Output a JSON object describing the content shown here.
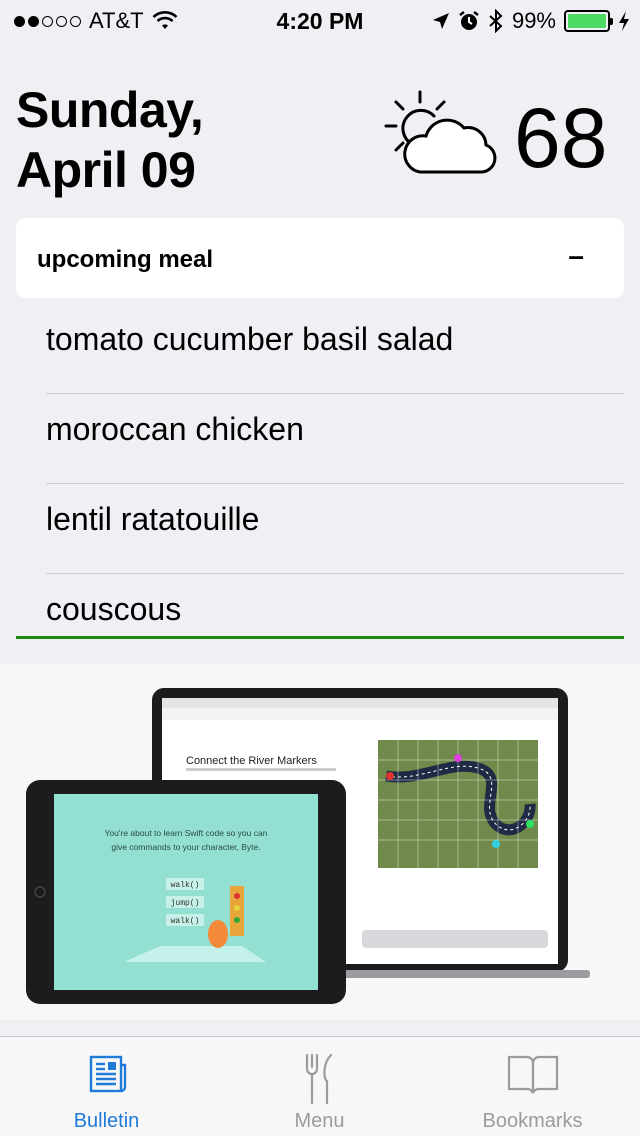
{
  "status_bar": {
    "signal_dots": [
      true,
      true,
      false,
      false,
      false
    ],
    "carrier": "AT&T",
    "time": "4:20 PM",
    "battery_percent": "99%",
    "battery_level": 0.99,
    "icons": [
      "wifi-icon",
      "location-icon",
      "alarm-icon",
      "bluetooth-icon",
      "battery-icon",
      "charging-icon"
    ]
  },
  "header": {
    "day": "Sunday,",
    "date": "April 09",
    "weather_icon": "partly-cloudy-icon",
    "temperature": "68"
  },
  "meal_card": {
    "title": "upcoming meal",
    "toggle_label": "–",
    "items": [
      "tomato cucumber basil salad",
      "moroccan chicken",
      "lentil ratatouille",
      "couscous"
    ],
    "accent_color": "#1a8c12"
  },
  "promo": {
    "ipad_text": "You're about to learn Swift code so you can give commands to your character, Byte.",
    "commands": [
      "walk()",
      "jump()",
      "walk()"
    ],
    "mac_heading": "Connect the River Markers"
  },
  "tab_bar": {
    "active_color": "#1f7ad8",
    "tabs": [
      {
        "label": "Bulletin",
        "icon": "newspaper-icon",
        "active": true
      },
      {
        "label": "Menu",
        "icon": "fork-knife-icon",
        "active": false
      },
      {
        "label": "Bookmarks",
        "icon": "book-icon",
        "active": false
      }
    ]
  }
}
